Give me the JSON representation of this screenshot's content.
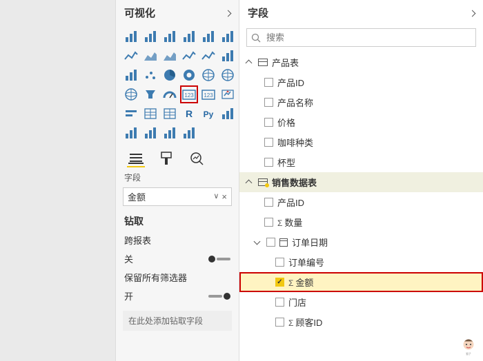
{
  "vizPanel": {
    "title": "可视化",
    "icons": [
      "stacked-bar",
      "clustered-bar",
      "stacked-col",
      "clustered-col",
      "stacked-col-100",
      "clustered-col-100",
      "line",
      "area",
      "stacked-area",
      "line-col",
      "line-col2",
      "ribbon",
      "waterfall",
      "scatter",
      "pie",
      "donut",
      "treemap",
      "map",
      "filled-map",
      "funnel",
      "gauge",
      "card",
      "multi-row-card",
      "kpi",
      "slicer",
      "table",
      "matrix",
      "r",
      "py",
      "key-inf",
      "decomp",
      "qna",
      "paginated",
      "custom"
    ],
    "highlightedIndex": 21,
    "tabs": {
      "fieldsTab": "fields",
      "formatTab": "format",
      "analyticsTab": "analytics"
    },
    "wellLabel": "字段",
    "wellValue": "金额",
    "drill": {
      "title": "钻取",
      "crossReport": "跨报表",
      "off": "关",
      "keepFilters": "保留所有筛选器",
      "on": "开",
      "dropHint": "在此处添加钻取字段"
    }
  },
  "fieldsPanel": {
    "title": "字段",
    "searchPlaceholder": "搜索",
    "tables": [
      {
        "name": "产品表",
        "expanded": true,
        "active": false,
        "fields": [
          {
            "label": "产品ID",
            "checked": false,
            "sigma": false
          },
          {
            "label": "产品名称",
            "checked": false,
            "sigma": false
          },
          {
            "label": "价格",
            "checked": false,
            "sigma": false
          },
          {
            "label": "咖啡种类",
            "checked": false,
            "sigma": false
          },
          {
            "label": "杯型",
            "checked": false,
            "sigma": false
          }
        ]
      },
      {
        "name": "销售数据表",
        "expanded": true,
        "active": true,
        "fields": [
          {
            "label": "产品ID",
            "checked": false,
            "sigma": false
          },
          {
            "label": "数量",
            "checked": false,
            "sigma": true
          },
          {
            "label": "订单日期",
            "checked": false,
            "sigma": false,
            "isDate": true,
            "expanded": true,
            "children": [
              {
                "label": "订单编号",
                "checked": false,
                "sigma": false
              },
              {
                "label": "金额",
                "checked": true,
                "sigma": true,
                "highlighted": true
              },
              {
                "label": "门店",
                "checked": false,
                "sigma": false
              },
              {
                "label": "顾客ID",
                "checked": false,
                "sigma": true
              }
            ]
          }
        ]
      }
    ]
  }
}
